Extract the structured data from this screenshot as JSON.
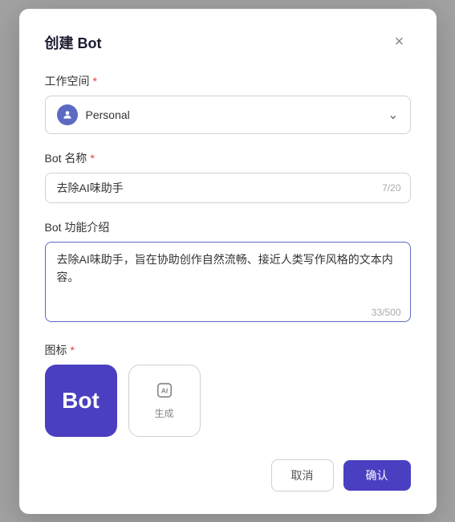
{
  "modal": {
    "title": "创建 Bot",
    "close_label": "×"
  },
  "workspace_field": {
    "label": "工作空间",
    "required": true,
    "value": "Personal",
    "avatar_icon": "person-icon"
  },
  "bot_name_field": {
    "label": "Bot 名称",
    "required": true,
    "value": "去除AI味助手",
    "char_count": "7/20"
  },
  "bot_desc_field": {
    "label": "Bot 功能介绍",
    "required": false,
    "value": "去除AI味助手，旨在协助创作自然流畅、接近人类写作风格的文本内容。",
    "char_count": "33/500"
  },
  "icon_field": {
    "label": "图标",
    "required": true,
    "selected_icon_text": "Bot",
    "generate_button_label": "生成"
  },
  "footer": {
    "cancel_label": "取消",
    "confirm_label": "确认"
  }
}
